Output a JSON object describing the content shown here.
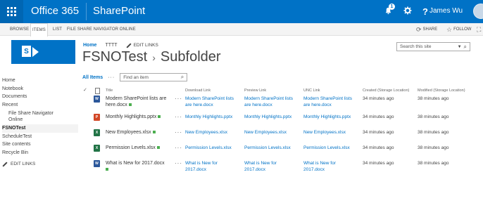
{
  "suitebar": {
    "brand": "Office 365",
    "app": "SharePoint",
    "notification_count": "1",
    "user": "James Wu",
    "colors": {
      "bar": "#0072c6",
      "waffle": "#0066b3"
    }
  },
  "ribbon": {
    "tabs": [
      "BROWSE",
      "ITEMS",
      "LIST",
      "FILE SHARE NAVIGATOR ONLINE"
    ],
    "selected_tab": "ITEMS",
    "actions": {
      "share": "SHARE",
      "follow": "FOLLOW"
    }
  },
  "topnav": {
    "home": "Home",
    "item": "TTTT",
    "edit_links": "EDIT LINKS"
  },
  "page": {
    "title": "FSNOTest",
    "title_sep": "›",
    "subtitle": "Subfolder"
  },
  "search": {
    "placeholder": "Search this site"
  },
  "leftnav": {
    "items": [
      {
        "label": "Home"
      },
      {
        "label": "Notebook"
      },
      {
        "label": "Documents"
      },
      {
        "label": "Recent"
      }
    ],
    "recent_sub": [
      "File Share Navigator",
      "Online"
    ],
    "items2": [
      {
        "label": "FSNOTest",
        "selected": true
      },
      {
        "label": "ScheduleTest"
      },
      {
        "label": "Site contents"
      },
      {
        "label": "Recycle Bin"
      }
    ],
    "edit_links": "EDIT LINKS"
  },
  "library": {
    "view": "All Items",
    "more": "···",
    "find_placeholder": "Find an item"
  },
  "table": {
    "headers": {
      "title": "Title",
      "download": "Download Link",
      "preview": "Preview Link",
      "unc": "UNC Link",
      "created": "Created (Storage Location)",
      "modified": "Modified (Storage Location)"
    },
    "rows": [
      {
        "icon": "word",
        "title_line1": "Modern SharePoint lists are",
        "title_line2": "here.docx",
        "download_line1": "Modern SharePoint lists",
        "download_line2": "are here.docx",
        "preview_line1": "Modern SharePoint lists",
        "preview_line2": "are here.docx",
        "unc_line1": "Modern SharePoint lists",
        "unc_line2": "are here.docx",
        "created": "34 minutes ago",
        "modified": "38 minutes ago"
      },
      {
        "icon": "ppt",
        "title_line1": "Monthly Highlights.pptx",
        "title_line2": "",
        "download_line1": "Monthly Highlights.pptx",
        "download_line2": "",
        "preview_line1": "Monthly Highlights.pptx",
        "preview_line2": "",
        "unc_line1": "Monthly Highlights.pptx",
        "unc_line2": "",
        "created": "34 minutes ago",
        "modified": "38 minutes ago"
      },
      {
        "icon": "xls",
        "title_line1": "New Employees.xlsx",
        "title_line2": "",
        "download_line1": "New Employees.xlsx",
        "download_line2": "",
        "preview_line1": "New Employees.xlsx",
        "preview_line2": "",
        "unc_line1": "New Employees.xlsx",
        "unc_line2": "",
        "created": "34 minutes ago",
        "modified": "38 minutes ago"
      },
      {
        "icon": "xls",
        "title_line1": "Permission Levels.xlsx",
        "title_line2": "",
        "download_line1": "Permission Levels.xlsx",
        "download_line2": "",
        "preview_line1": "Permission Levels.xlsx",
        "preview_line2": "",
        "unc_line1": "Permission Levels.xlsx",
        "unc_line2": "",
        "created": "34 minutes ago",
        "modified": "38 minutes ago"
      },
      {
        "icon": "word",
        "title_line1": "What is New for 2017.docx",
        "title_line2": "",
        "download_line1": "What is New for",
        "download_line2": "2017.docx",
        "preview_line1": "What is New for",
        "preview_line2": "2017.docx",
        "unc_line1": "What is New for",
        "unc_line2": "2017.docx",
        "created": "34 minutes ago",
        "modified": "38 minutes ago"
      }
    ]
  }
}
